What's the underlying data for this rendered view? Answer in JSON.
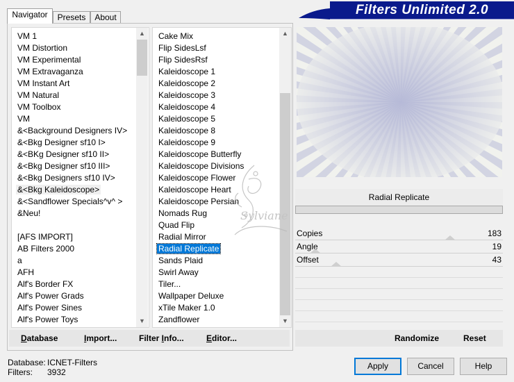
{
  "title": "Filters Unlimited 2.0",
  "tabs": [
    "Navigator",
    "Presets",
    "About"
  ],
  "categories": [
    "VM 1",
    "VM Distortion",
    "VM Experimental",
    "VM Extravaganza",
    "VM Instant Art",
    "VM Natural",
    "VM Toolbox",
    "VM",
    "&<Background Designers IV>",
    "&<Bkg Designer sf10 I>",
    "&<BKg Designer sf10 II>",
    "&<Bkg Designer sf10 III>",
    "&<Bkg Designers sf10 IV>",
    "&<Bkg Kaleidoscope>",
    "&<Sandflower Specials^v^ >",
    "&Neu!",
    "",
    "[AFS IMPORT]",
    "AB Filters 2000",
    "a",
    "AFH",
    "Alf's Border FX",
    "Alf's Power Grads",
    "Alf's Power Sines",
    "Alf's Power Toys"
  ],
  "selected_category": "&<Bkg Kaleidoscope>",
  "filters": [
    "Cake Mix",
    "Flip SidesLsf",
    "Flip SidesRsf",
    "Kaleidoscope 1",
    "Kaleidoscope 2",
    "Kaleidoscope 3",
    "Kaleidoscope 4",
    "Kaleidoscope 5",
    "Kaleidoscope 8",
    "Kaleidoscope 9",
    "Kaleidoscope Butterfly",
    "Kaleidoscope Divisions",
    "Kaleidoscope Flower",
    "Kaleidoscope Heart",
    "Kaleidoscope Persian",
    "Nomads Rug",
    "Quad Flip",
    "Radial Mirror",
    "Radial Replicate",
    "Sands Plaid",
    "Swirl Away",
    "Tiler...",
    "Wallpaper Deluxe",
    "xTile Maker 1.0",
    "Zandflower"
  ],
  "selected_filter": "Radial Replicate",
  "preview_filter_name": "Radial Replicate",
  "parameters": [
    {
      "label": "Copies",
      "value": "183",
      "slider_fraction": 0.72
    },
    {
      "label": "Angle",
      "value": "19",
      "slider_fraction": 0.07
    },
    {
      "label": "Offset",
      "value": "43",
      "slider_fraction": 0.17
    }
  ],
  "toolbar": {
    "database": {
      "pre": "",
      "u": "D",
      "post": "atabase"
    },
    "import": {
      "pre": "",
      "u": "I",
      "post": "mport..."
    },
    "filter_info": {
      "pre": "Filter ",
      "u": "I",
      "post": "nfo..."
    },
    "editor": {
      "pre": "",
      "u": "E",
      "post": "ditor..."
    },
    "randomize": "Randomize",
    "reset": "Reset"
  },
  "status": {
    "database_label": "Database:",
    "database_value": "ICNET-Filters",
    "filters_label": "Filters:",
    "filters_value": "3932"
  },
  "buttons": {
    "apply": "Apply",
    "cancel": "Cancel",
    "help": "Help"
  },
  "watermark": "Sylviane",
  "colors": {
    "title_bar": "#0a1a8c",
    "selection": "#0078d7",
    "preview_rays": "#b8bcd8"
  }
}
